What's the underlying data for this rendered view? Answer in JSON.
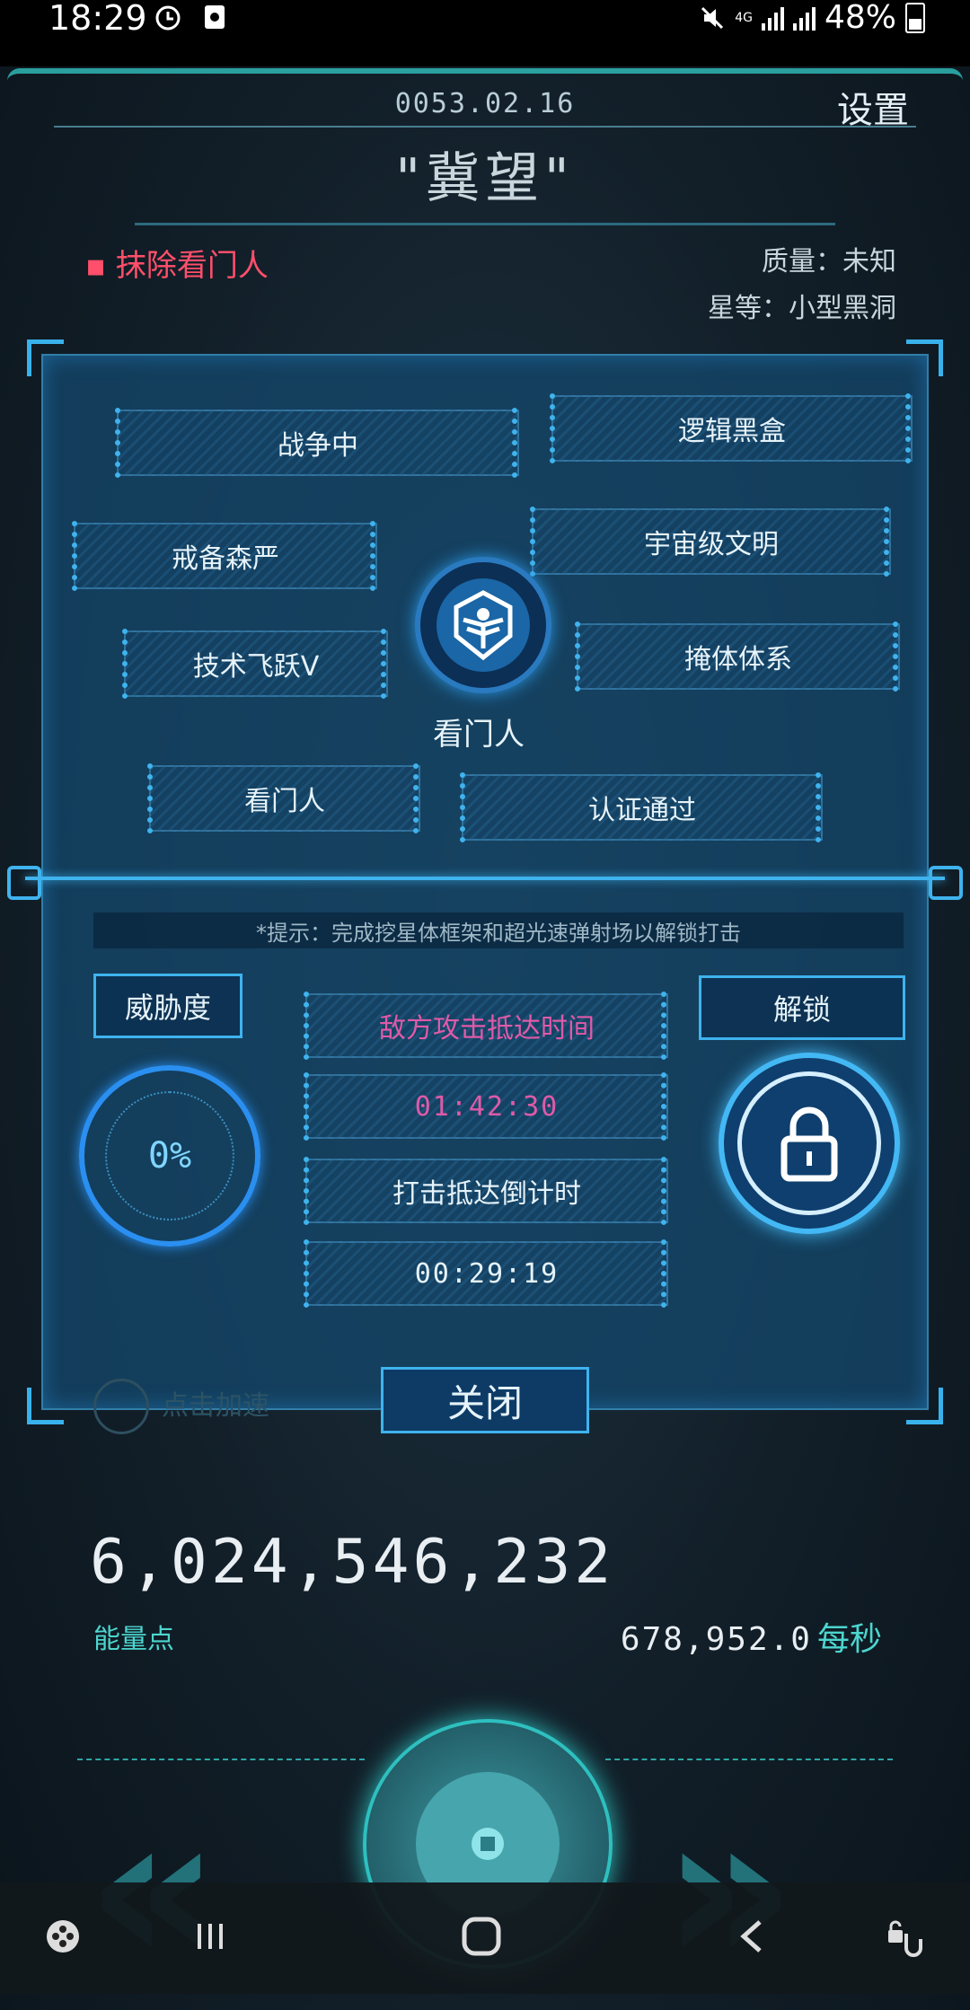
{
  "status_bar": {
    "time": "18:29",
    "network": "4G",
    "battery": "48%"
  },
  "header": {
    "date": "0053.02.16",
    "settings_label": "设置",
    "planet_name": "\"冀望\""
  },
  "info": {
    "mission": "抹除看门人",
    "mass_label": "质量：未知",
    "star_label": "星等：小型黑洞"
  },
  "tags": {
    "war": "战争中",
    "logic_box": "逻辑黑盒",
    "alert": "戒备森严",
    "cosmic": "宇宙级文明",
    "tech": "技术飞跃V",
    "bunker": "掩体体系",
    "watcher": "看门人",
    "certified": "认证通过"
  },
  "emblem": {
    "icon": "watcher-emblem-icon",
    "label": "看门人"
  },
  "hint": "*提示：完成挖星体框架和超光速弹射场以解锁打击",
  "threat": {
    "label": "威胁度",
    "value": "0%"
  },
  "unlock": {
    "label": "解锁",
    "icon": "lock-icon"
  },
  "times": {
    "enemy_label": "敌方攻击抵达时间",
    "enemy_time": "01:42:30",
    "strike_label": "打击抵达倒计时",
    "strike_time": "00:29:19"
  },
  "boost_label": "点击加速",
  "close_label": "关闭",
  "energy": {
    "value": "6,024,546,232",
    "label": "能量点",
    "rate": "678,952.0",
    "rate_unit": "每秒"
  },
  "colors": {
    "accent": "#3fb3ee",
    "teal": "#4cd6cf",
    "mission": "#ff4f6a",
    "enemy": "#e05aa8"
  }
}
